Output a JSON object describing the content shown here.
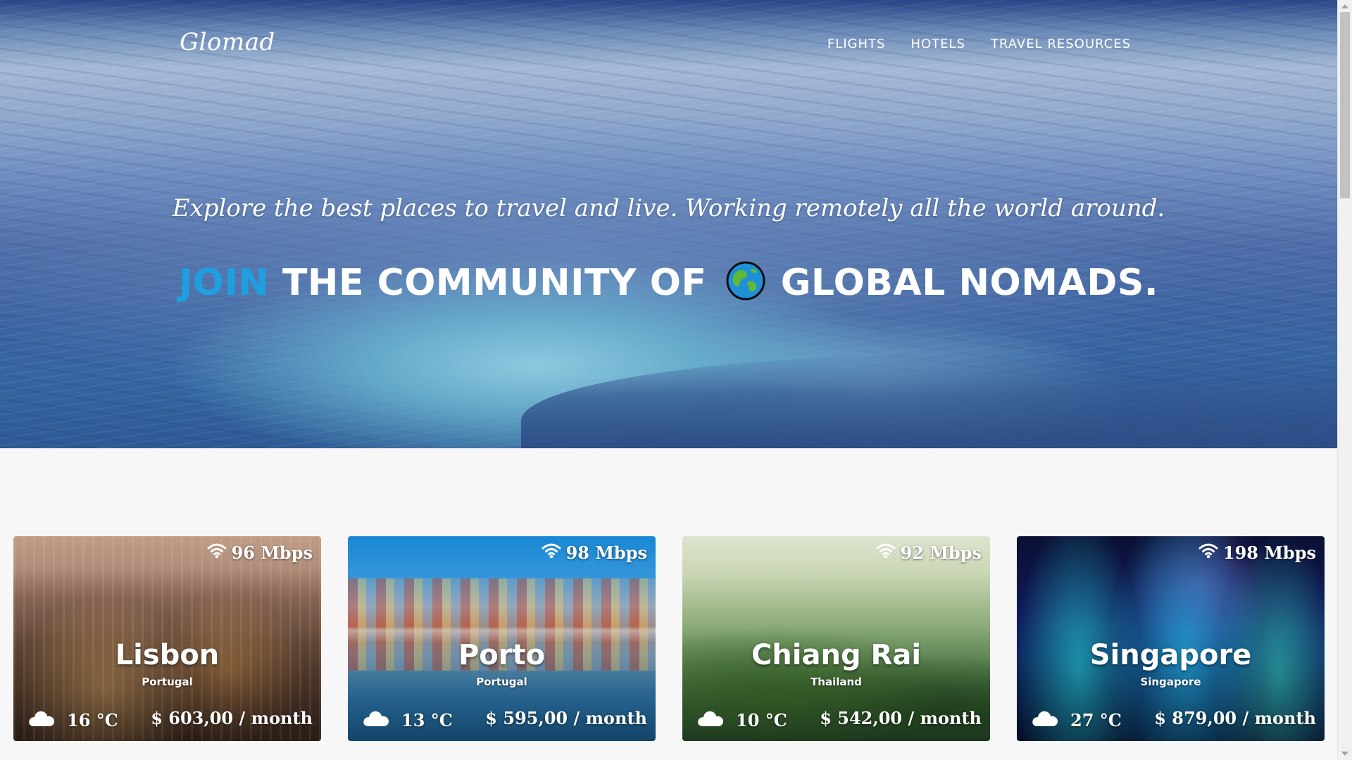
{
  "brand": {
    "logo": "Glomad"
  },
  "nav": {
    "items": [
      {
        "label": "FLIGHTS"
      },
      {
        "label": "HOTELS"
      },
      {
        "label": "TRAVEL RESOURCES"
      }
    ]
  },
  "hero": {
    "tagline": "Explore the best places to travel and live. Working remotely all the world around.",
    "headline": {
      "join": "JOIN",
      "middle": "THE COMMUNITY OF",
      "end": "GLOBAL NOMADS.",
      "accent_color": "#1e9fe0"
    }
  },
  "cities": [
    {
      "name": "Lisbon",
      "country": "Portugal",
      "speed": "96 Mbps",
      "temp": "16 °C",
      "cost": "$ 603,00 / month",
      "weather_icon": "cloud-icon"
    },
    {
      "name": "Porto",
      "country": "Portugal",
      "speed": "98 Mbps",
      "temp": "13 °C",
      "cost": "$ 595,00 / month",
      "weather_icon": "cloud-icon"
    },
    {
      "name": "Chiang Rai",
      "country": "Thailand",
      "speed": "92 Mbps",
      "temp": "10 °C",
      "cost": "$ 542,00 / month",
      "weather_icon": "cloud-icon"
    },
    {
      "name": "Singapore",
      "country": "Singapore",
      "speed": "198 Mbps",
      "temp": "27 °C",
      "cost": "$ 879,00 / month",
      "weather_icon": "cloud-icon"
    }
  ]
}
